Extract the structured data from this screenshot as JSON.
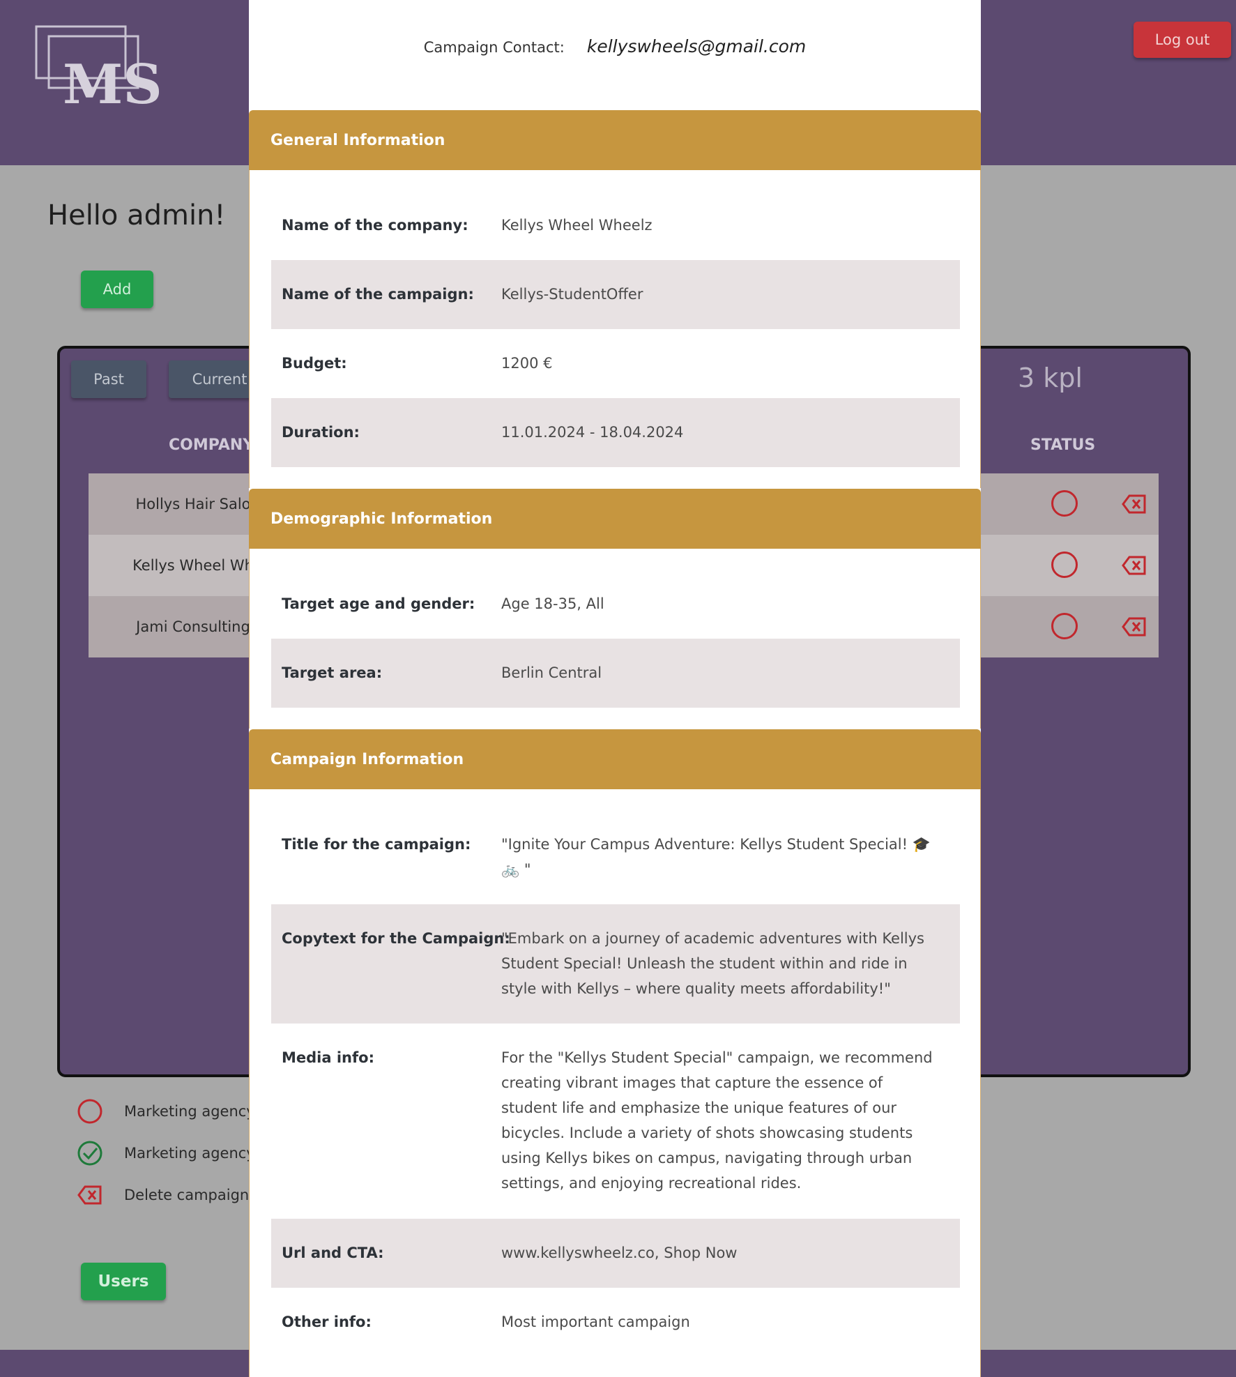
{
  "header": {
    "logo_text": "MS",
    "logout_label": "Log out"
  },
  "page": {
    "greeting": "Hello admin!",
    "add_label": "Add",
    "users_label": "Users"
  },
  "campaigns": {
    "tabs": [
      {
        "label": "Past"
      },
      {
        "label": "Current"
      }
    ],
    "count_label": "3 kpl",
    "columns": {
      "company": "COMPANY",
      "status": "STATUS"
    },
    "rows": [
      {
        "company": "Hollys Hair Salo"
      },
      {
        "company": "Kellys Wheel Wh"
      },
      {
        "company": "Jami Consulting"
      }
    ]
  },
  "legend": [
    {
      "icon": "status-open-circle-icon",
      "text": "Marketing agency"
    },
    {
      "icon": "status-done-check-icon",
      "text": "Marketing agency"
    },
    {
      "icon": "delete-icon",
      "text": "Delete campaign."
    }
  ],
  "colors": {
    "header_purple": "#5c4a70",
    "section_gold": "#c6963f",
    "green_button": "#23a04d",
    "red_button": "#c8343a",
    "status_red": "#c1272d"
  },
  "modal": {
    "contact_label": "Campaign Contact:",
    "contact_value": "kellyswheels@gmail.com",
    "general": {
      "title": "General Information",
      "fields": [
        {
          "label": "Name of the company:",
          "value": "Kellys Wheel Wheelz"
        },
        {
          "label": "Name of the campaign:",
          "value": "Kellys-StudentOffer"
        },
        {
          "label": "Budget:",
          "value": "1200 €"
        },
        {
          "label": "Duration:",
          "value": "11.01.2024 - 18.04.2024"
        }
      ]
    },
    "demographic": {
      "title": "Demographic Information",
      "fields": [
        {
          "label": "Target age and gender:",
          "value": "Age 18-35, All"
        },
        {
          "label": "Target area:",
          "value": "Berlin Central"
        }
      ]
    },
    "campaign": {
      "title": "Campaign Information",
      "fields": [
        {
          "label": "Title for the campaign:",
          "value": "\"Ignite Your Campus Adventure: Kellys Student Special! 🎓 🚲 \""
        },
        {
          "label": "Copytext for the Campaign:",
          "value": "\"Embark on a journey of academic adventures with Kellys Student Special! Unleash the student within and ride in style with Kellys – where quality meets affordability!\""
        },
        {
          "label": "Media info:",
          "value": "For the \"Kellys Student Special\" campaign, we recommend creating vibrant images that capture the essence of student life and emphasize the unique features of our bicycles. Include a variety of shots showcasing students using Kellys bikes on campus, navigating through urban settings, and enjoying recreational rides."
        },
        {
          "label": "Url and CTA:",
          "value": "www.kellyswheelz.co, Shop Now"
        },
        {
          "label": "Other info:",
          "value": "Most important campaign"
        }
      ]
    }
  }
}
